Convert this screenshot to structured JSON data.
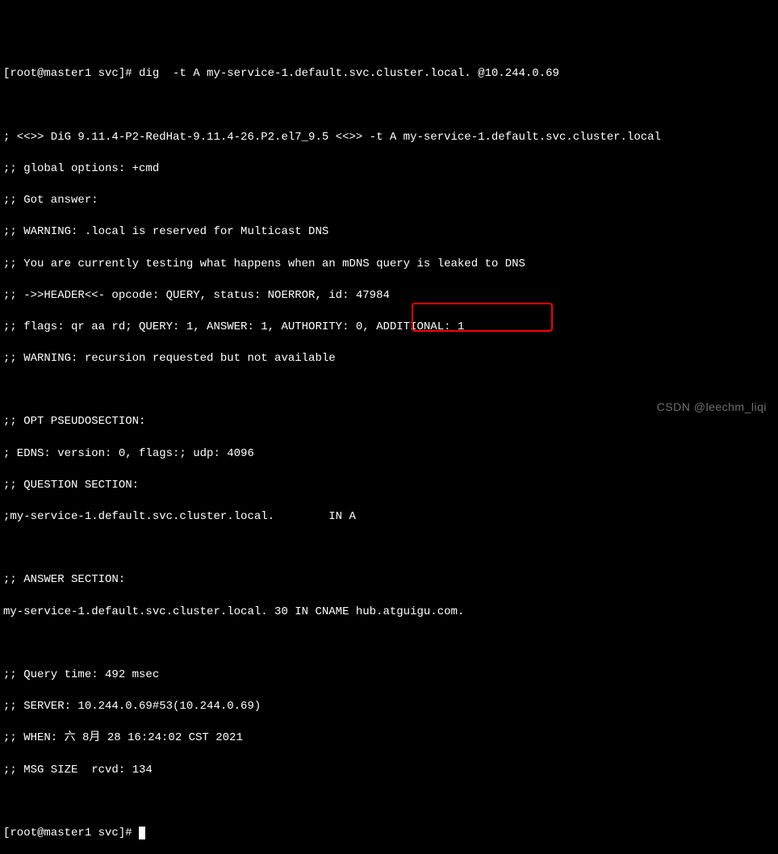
{
  "prompt1_full": "[root@master1 svc]# dig  -t A my-service-1.default.svc.cluster.local. @10.244.0.69",
  "lines": {
    "l01": "; <<>> DiG 9.11.4-P2-RedHat-9.11.4-26.P2.el7_9.5 <<>> -t A my-service-1.default.svc.cluster.local",
    "l02": ";; global options: +cmd",
    "l03": ";; Got answer:",
    "l04": ";; WARNING: .local is reserved for Multicast DNS",
    "l05": ";; You are currently testing what happens when an mDNS query is leaked to DNS",
    "l06": ";; ->>HEADER<<- opcode: QUERY, status: NOERROR, id: 47984",
    "l07": ";; flags: qr aa rd; QUERY: 1, ANSWER: 1, AUTHORITY: 0, ADDITIONAL: 1",
    "l08": ";; WARNING: recursion requested but not available",
    "l09": ";; OPT PSEUDOSECTION:",
    "l10": "; EDNS: version: 0, flags:; udp: 4096",
    "l11": ";; QUESTION SECTION:",
    "l12": ";my-service-1.default.svc.cluster.local.        IN A",
    "l13": ";; ANSWER SECTION:",
    "l14": "my-service-1.default.svc.cluster.local. 30 IN CNAME hub.atguigu.com.",
    "l15": ";; Query time: 492 msec",
    "l16": ";; SERVER: 10.244.0.69#53(10.244.0.69)",
    "l17": ";; WHEN: 六 8月 28 16:24:02 CST 2021",
    "l18": ";; MSG SIZE  rcvd: 134"
  },
  "prompt2_full": "[root@master1 svc]# ",
  "watermark": "CSDN @leechm_liqi"
}
